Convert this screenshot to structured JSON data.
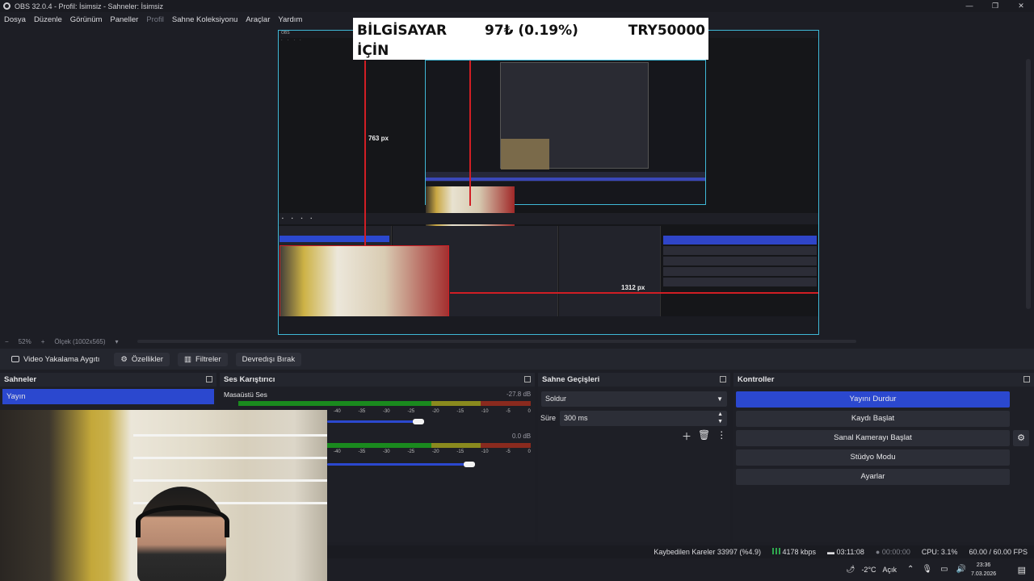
{
  "window": {
    "title": "OBS 32.0.4 - Profil: İsimsiz - Sahneler: İsimsiz",
    "controls": [
      "—",
      "❐",
      "✕"
    ]
  },
  "menu": [
    "Dosya",
    "Düzenle",
    "Görünüm",
    "Paneller",
    "Profil",
    "Sahne Koleksiyonu",
    "Araçlar",
    "Yardım"
  ],
  "ticker": {
    "label_line1": "BİLGİSAYAR",
    "label_line2": "İÇİN",
    "amount": "97₺ (0.19%)",
    "goal": "TRY50000"
  },
  "preview": {
    "measure_height": "763 px",
    "measure_width": "1312 px"
  },
  "zoom": {
    "percent": "52%",
    "scale_label": "Ölçek (1002x565)"
  },
  "source_toolbar": {
    "source_name": "Video Yakalama Aygıtı",
    "properties": "Özellikler",
    "filters": "Filtreler",
    "deactivate": "Devredışı Bırak"
  },
  "scenes": {
    "title": "Sahneler",
    "items": [
      "Yayın"
    ]
  },
  "mixer": {
    "title": "Ses Karıştırıcı",
    "channels": [
      {
        "name": "Masaüstü Ses",
        "db": "-27.8 dB",
        "level": 0.45
      },
      {
        "name": "",
        "db": "0.0 dB",
        "level": 0.7
      }
    ],
    "scale": [
      "-40",
      "-35",
      "-30",
      "-25",
      "-20",
      "-15",
      "-10",
      "-5",
      "0"
    ]
  },
  "transitions": {
    "title": "Sahne Geçişleri",
    "type": "Soldur",
    "duration_label": "Süre",
    "duration": "300 ms"
  },
  "controls": {
    "title": "Kontroller",
    "buttons": [
      "Yayını Durdur",
      "Kaydı Başlat",
      "Sanal Kamerayı Başlat",
      "Stüdyo Modu",
      "Ayarlar"
    ]
  },
  "status": {
    "dropped": "Kaybedilen Kareler 33997 (%4.9)",
    "bitrate": "4178 kbps",
    "stream_time": "03:11:08",
    "rec_time": "00:00:00",
    "cpu": "CPU: 3.1%",
    "fps": "60.00 / 60.00 FPS"
  },
  "taskbar": {
    "temp": "-2°C",
    "weather": "Açık",
    "time": "23:36",
    "date": "7.03.2026"
  },
  "colors": {
    "accent": "#2b48cf",
    "preview_border": "#3fb8d6",
    "measure": "#d11e24"
  }
}
